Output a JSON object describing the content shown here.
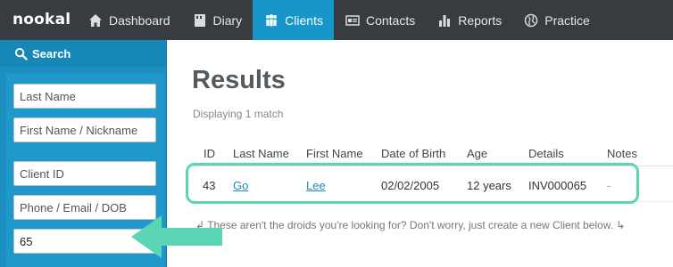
{
  "app": {
    "logo": "nookal"
  },
  "nav": {
    "items": [
      {
        "label": "Dashboard",
        "icon": "home-icon"
      },
      {
        "label": "Diary",
        "icon": "diary-icon"
      },
      {
        "label": "Clients",
        "icon": "people-icon",
        "active": true
      },
      {
        "label": "Contacts",
        "icon": "address-card-icon"
      },
      {
        "label": "Reports",
        "icon": "bar-chart-icon"
      },
      {
        "label": "Practice",
        "icon": "globe-icon"
      }
    ]
  },
  "sidebar": {
    "title": "Search",
    "fields": {
      "last_name": "Last Name",
      "first_name": "First Name / Nickname",
      "client_id": "Client ID",
      "phone_email_dob": "Phone / Email / DOB",
      "invoice_value": "65"
    }
  },
  "results": {
    "title": "Results",
    "subtitle": "Displaying 1 match",
    "columns": [
      "ID",
      "Last Name",
      "First Name",
      "Date of Birth",
      "Age",
      "Details",
      "Notes"
    ],
    "row": {
      "id": "43",
      "last_name": "Go",
      "first_name": "Lee",
      "dob": "02/02/2005",
      "age": "12 years",
      "details": "INV000065",
      "notes": "-"
    },
    "hint": "These aren't the droids you're looking for? Don't worry, just create a new Client below."
  },
  "colors": {
    "accent": "#1796c9",
    "navbar": "#383b3f",
    "highlight": "#5bd5b4"
  }
}
